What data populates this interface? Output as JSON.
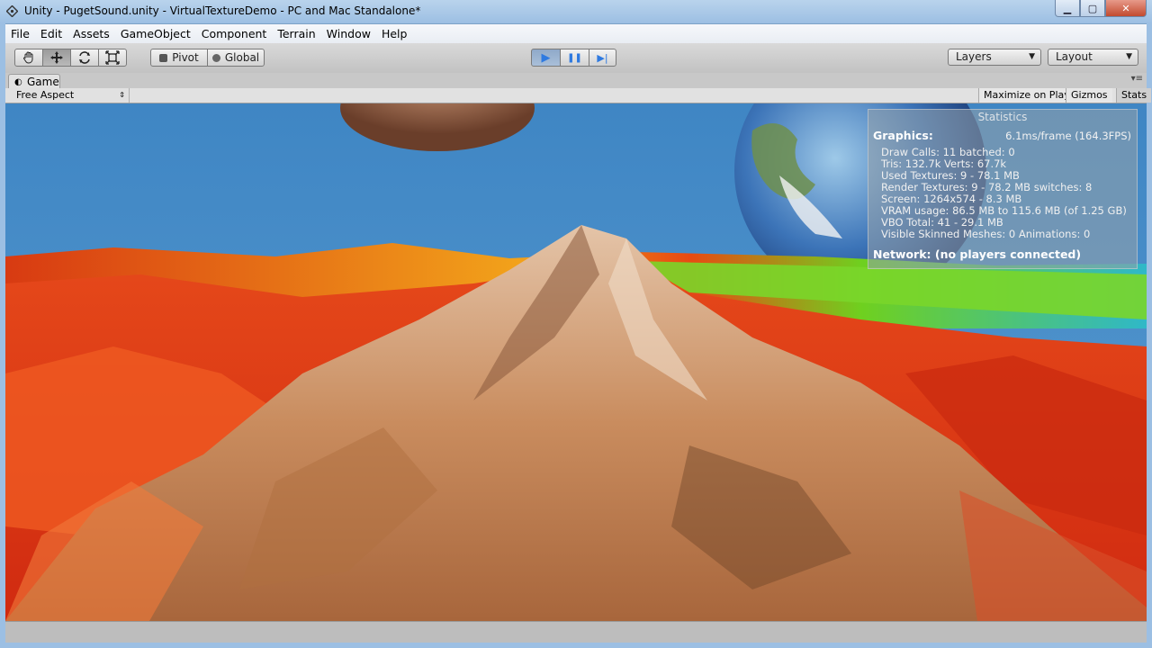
{
  "window": {
    "title": "Unity - PugetSound.unity - VirtualTextureDemo - PC and Mac Standalone*",
    "minimize": "▁",
    "maximize": "▢",
    "close": "✕"
  },
  "menu": [
    "File",
    "Edit",
    "Assets",
    "GameObject",
    "Component",
    "Terrain",
    "Window",
    "Help"
  ],
  "toolbar": {
    "tools": [
      "hand-icon",
      "move-icon",
      "rotate-icon",
      "scale-icon"
    ],
    "pivot_label": "Pivot",
    "global_label": "Global",
    "play_icon": "▶",
    "pause_icon": "❚❚",
    "step_icon": "▶|",
    "layers_label": "Layers",
    "layout_label": "Layout"
  },
  "tab": {
    "label": "Game",
    "aspect": "Free Aspect",
    "maximize_on_play": "Maximize on Play",
    "gizmos": "Gizmos",
    "stats": "Stats"
  },
  "statistics": {
    "title": "Statistics",
    "graphics_label": "Graphics:",
    "frame_time": "6.1ms/frame (164.3FPS)",
    "lines": [
      "Draw Calls: 11    batched: 0",
      "Tris: 132.7k    Verts: 67.7k",
      "Used Textures: 9 - 78.1 MB",
      "Render Textures: 9 - 78.2 MB    switches: 8",
      "Screen: 1264x574 - 8.3 MB",
      "VRAM usage: 86.5 MB to 115.6 MB (of 1.25 GB)",
      "VBO Total: 41 - 29.1 MB",
      "Visible Skinned Meshes: 0      Animations: 0"
    ],
    "network": "Network: (no players connected)"
  },
  "colors": {
    "sky": "#4f8fc7",
    "terrain_red": "#e0391a",
    "terrain_tan": "#c9946a",
    "play_active": "#5b8fd6"
  }
}
